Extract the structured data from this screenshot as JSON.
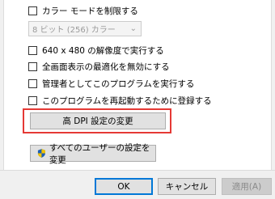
{
  "options": {
    "reduced_color": "カラー モードを制限する",
    "color_select_value": "8 ビット (256) カラー",
    "run_640x480": "640 x 480 の解像度で実行する",
    "disable_fullscreen_opt": "全画面表示の最適化を無効にする",
    "run_as_admin": "管理者としてこのプログラムを実行する",
    "register_restart": "このプログラムを再起動するために登録する"
  },
  "buttons": {
    "high_dpi": "高 DPI 設定の変更",
    "all_users": "すべてのユーザーの設定を変更",
    "ok": "OK",
    "cancel": "キャンセル",
    "apply": "適用(A)"
  },
  "colors": {
    "highlight": "#e53935",
    "ok_border": "#0078d7",
    "shield_blue": "#1e5fb4",
    "shield_yellow": "#f2c300"
  }
}
